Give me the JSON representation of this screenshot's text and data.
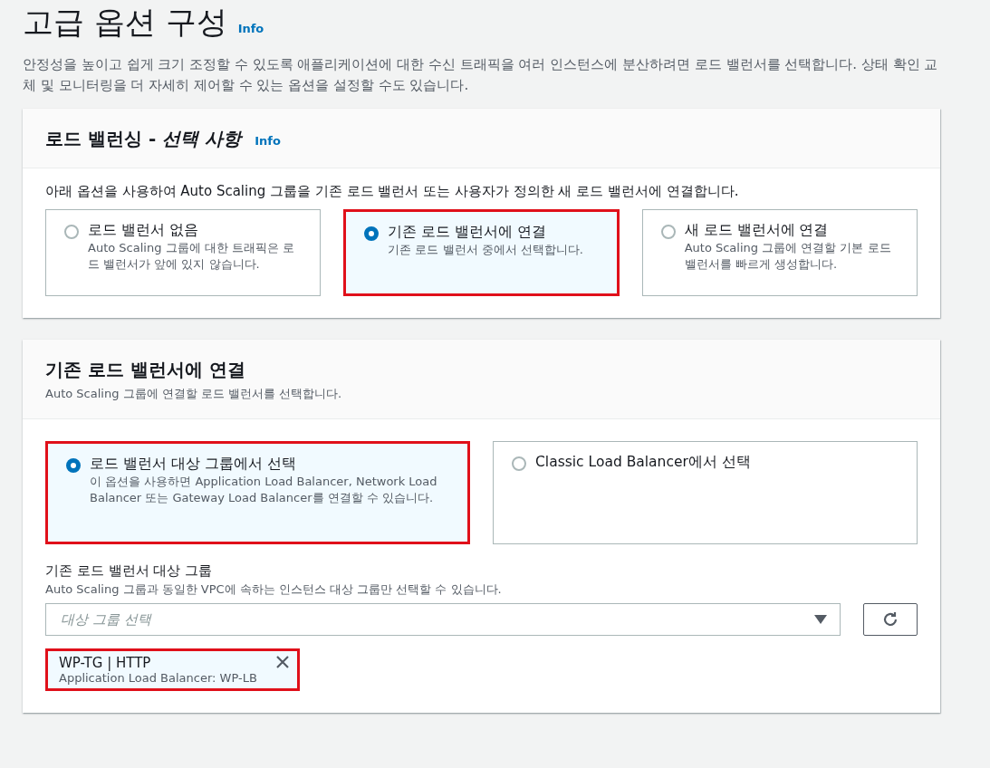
{
  "page": {
    "title": "고급 옵션 구성",
    "info": "Info",
    "description": "안정성을 높이고 쉽게 크기 조정할 수 있도록 애플리케이션에 대한 수신 트래픽을 여러 인스턴스에 분산하려면 로드 밸런서를 선택합니다. 상태 확인 교체 및 모니터링을 더 자세히 제어할 수 있는 옵션을 설정할 수도 있습니다."
  },
  "load_balancing": {
    "title": "로드 밸런싱 - *선택 사항*",
    "info": "Info",
    "description": "아래 옵션을 사용하여 Auto Scaling 그룹을 기존 로드 밸런서 또는 사용자가 정의한 새 로드 밸런서에 연결합니다.",
    "options": [
      {
        "label": "로드 밸런서 없음",
        "description": "Auto Scaling 그룹에 대한 트래픽은 로드 밸런서가 앞에 있지 않습니다.",
        "selected": false,
        "highlighted": false
      },
      {
        "label": "기존 로드 밸런서에 연결",
        "description": "기존 로드 밸런서 중에서 선택합니다.",
        "selected": true,
        "highlighted": true
      },
      {
        "label": "새 로드 밸런서에 연결",
        "description": "Auto Scaling 그룹에 연결할 기본 로드 밸런서를 빠르게 생성합니다.",
        "selected": false,
        "highlighted": false
      }
    ]
  },
  "attach_existing": {
    "title": "기존 로드 밸런서에 연결",
    "subtitle": "Auto Scaling 그룹에 연결할 로드 밸런서를 선택합니다.",
    "options": [
      {
        "label": "로드 밸런서 대상 그룹에서 선택",
        "description": "이 옵션을 사용하면 Application Load Balancer, Network Load Balancer 또는 Gateway Load Balancer를 연결할 수 있습니다.",
        "selected": true,
        "highlighted": true
      },
      {
        "label": "Classic Load Balancer에서 선택",
        "selected": false,
        "highlighted": false
      }
    ],
    "target_group": {
      "label": "기존 로드 밸런서 대상 그룹",
      "hint": "Auto Scaling 그룹과 동일한 VPC에 속하는 인스턴스 대상 그룹만 선택할 수 있습니다.",
      "placeholder": "대상 그룹 선택",
      "tokens": [
        {
          "title": "WP-TG | HTTP",
          "subtitle": "Application Load Balancer: WP-LB",
          "highlighted": true
        }
      ]
    }
  }
}
